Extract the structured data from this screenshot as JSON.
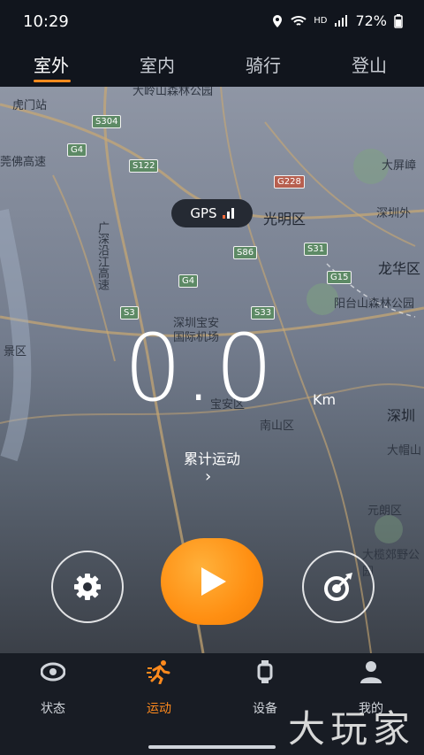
{
  "status": {
    "time": "10:29",
    "battery": "72%",
    "network": "HD"
  },
  "tabs": [
    "室外",
    "室内",
    "骑行",
    "登山"
  ],
  "map": {
    "labels": [
      "虎门站",
      "大岭山森林公园",
      "莞佛高速",
      "大屏嶂",
      "光明区",
      "深圳外",
      "龙华区",
      "阳台山森林公园",
      "深圳宝安",
      "国际机场",
      "宝安区",
      "南山区",
      "深圳",
      "元朗区",
      "大帽山",
      "景区",
      "大榄郊野公园",
      "广深沿江高速"
    ],
    "roads": [
      "S304",
      "G4",
      "S122",
      "G228",
      "S86",
      "S31",
      "G15",
      "G4",
      "S33",
      "S3"
    ]
  },
  "gps": {
    "label": "GPS"
  },
  "stats": {
    "value": "0.0",
    "unit": "Km",
    "total_label": "累计运动",
    "chevron": "›"
  },
  "nav": {
    "items": [
      "状态",
      "运动",
      "设备",
      "我的"
    ],
    "active": 1
  },
  "watermark": "大玩家",
  "colors": {
    "accent": "#ff8a1d",
    "bg": "#1d222c"
  }
}
